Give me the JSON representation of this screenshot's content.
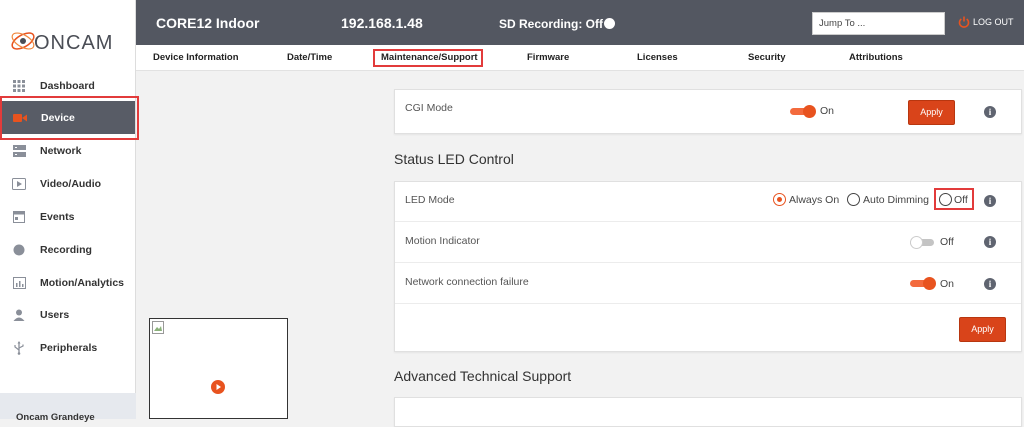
{
  "brand": {
    "name": "ONCAM"
  },
  "sidebar": {
    "items": [
      {
        "label": "Dashboard",
        "icon": "dashboard-grid-icon"
      },
      {
        "label": "Device",
        "icon": "camera-icon",
        "active": true
      },
      {
        "label": "Network",
        "icon": "server-icon"
      },
      {
        "label": "Video/Audio",
        "icon": "play-screen-icon"
      },
      {
        "label": "Events",
        "icon": "calendar-icon"
      },
      {
        "label": "Recording",
        "icon": "record-dot-icon"
      },
      {
        "label": "Motion/Analytics",
        "icon": "chart-icon"
      },
      {
        "label": "Users",
        "icon": "user-icon"
      },
      {
        "label": "Peripherals",
        "icon": "usb-icon"
      }
    ],
    "footer_device": "Oncam Grandeye"
  },
  "header": {
    "device_name": "CORE12 Indoor",
    "ip_address": "192.168.1.48",
    "sd_recording": "SD Recording: Off",
    "jump_placeholder": "Jump To ...",
    "logout": "LOG OUT"
  },
  "tabs": [
    "Device Information",
    "Date/Time",
    "Maintenance/Support",
    "Firmware",
    "Licenses",
    "Security",
    "Attributions"
  ],
  "active_tab": "Maintenance/Support",
  "cgi": {
    "label": "CGI Mode",
    "state": "On",
    "apply": "Apply"
  },
  "led": {
    "section_title": "Status LED Control",
    "mode_label": "LED Mode",
    "options": [
      "Always On",
      "Auto Dimming",
      "Off"
    ],
    "selected": "Always On",
    "motion_label": "Motion Indicator",
    "motion_state": "Off",
    "network_label": "Network connection failure",
    "network_state": "On",
    "apply": "Apply"
  },
  "advanced": {
    "section_title": "Advanced Technical Support"
  },
  "colors": {
    "accent": "#e8531f",
    "topbar": "#535761",
    "sidebar_active": "#585c66",
    "highlight_box": "#e23b3b"
  }
}
